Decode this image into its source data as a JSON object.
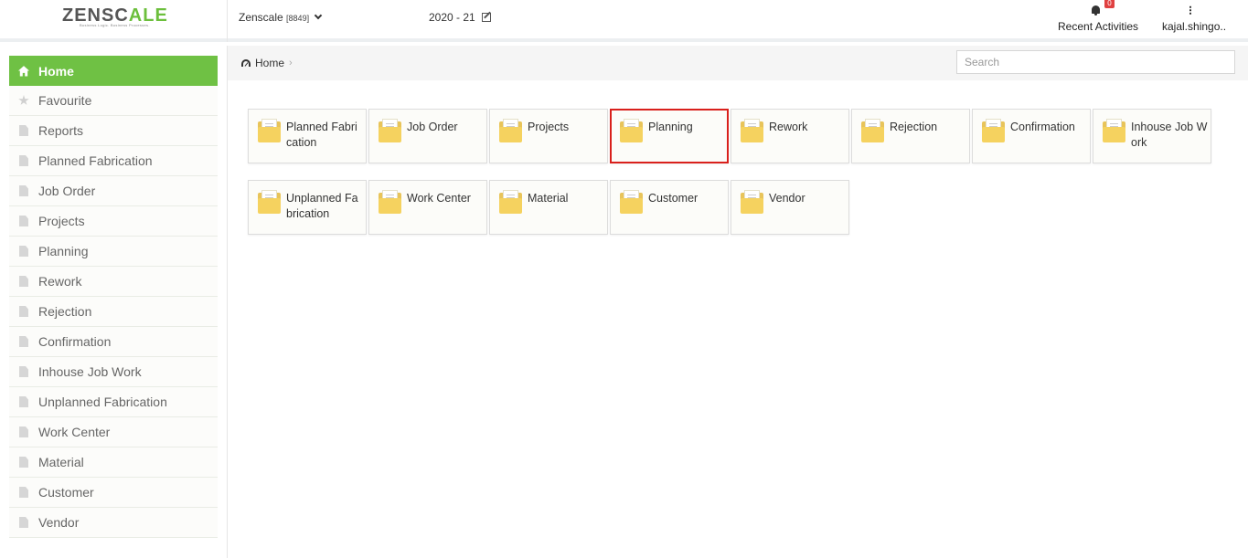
{
  "header": {
    "logo_text_1": "ZENSC",
    "logo_text_2": "A",
    "logo_text_3": "LE",
    "logo_tagline": "Business Logic. Business Processes.",
    "company_name": "Zenscale",
    "company_code": "[8849]",
    "financial_year": "2020 - 21",
    "notification_count": "0",
    "recent_activities": "Recent Activities",
    "user_name": "kajal.shingo.."
  },
  "sidebar": {
    "items": [
      {
        "label": "Home",
        "icon": "home-icon"
      },
      {
        "label": "Favourite",
        "icon": "star-icon"
      },
      {
        "label": "Reports",
        "icon": "document-icon"
      },
      {
        "label": "Planned Fabrication",
        "icon": "document-icon"
      },
      {
        "label": "Job Order",
        "icon": "document-icon"
      },
      {
        "label": "Projects",
        "icon": "document-icon"
      },
      {
        "label": "Planning",
        "icon": "document-icon"
      },
      {
        "label": "Rework",
        "icon": "document-icon"
      },
      {
        "label": "Rejection",
        "icon": "document-icon"
      },
      {
        "label": "Confirmation",
        "icon": "document-icon"
      },
      {
        "label": "Inhouse Job Work",
        "icon": "document-icon"
      },
      {
        "label": "Unplanned Fabrication",
        "icon": "document-icon"
      },
      {
        "label": "Work Center",
        "icon": "document-icon"
      },
      {
        "label": "Material",
        "icon": "document-icon"
      },
      {
        "label": "Customer",
        "icon": "document-icon"
      },
      {
        "label": "Vendor",
        "icon": "document-icon"
      }
    ]
  },
  "breadcrumb": {
    "home": "Home",
    "separator": "›"
  },
  "search": {
    "placeholder": "Search",
    "value": ""
  },
  "tiles": [
    {
      "label": "Planned Fabrication",
      "highlighted": false
    },
    {
      "label": "Job Order",
      "highlighted": false
    },
    {
      "label": "Projects",
      "highlighted": false
    },
    {
      "label": "Planning",
      "highlighted": true
    },
    {
      "label": "Rework",
      "highlighted": false
    },
    {
      "label": "Rejection",
      "highlighted": false
    },
    {
      "label": "Confirmation",
      "highlighted": false
    },
    {
      "label": "Inhouse Job Work",
      "highlighted": false
    },
    {
      "label": "Unplanned Fabrication",
      "highlighted": false
    },
    {
      "label": "Work Center",
      "highlighted": false
    },
    {
      "label": "Material",
      "highlighted": false
    },
    {
      "label": "Customer",
      "highlighted": false
    },
    {
      "label": "Vendor",
      "highlighted": false
    }
  ],
  "colors": {
    "accent_green": "#6fc144",
    "highlight_red": "#d9201c",
    "folder_yellow": "#f5d25f",
    "badge_red": "#e04141"
  }
}
